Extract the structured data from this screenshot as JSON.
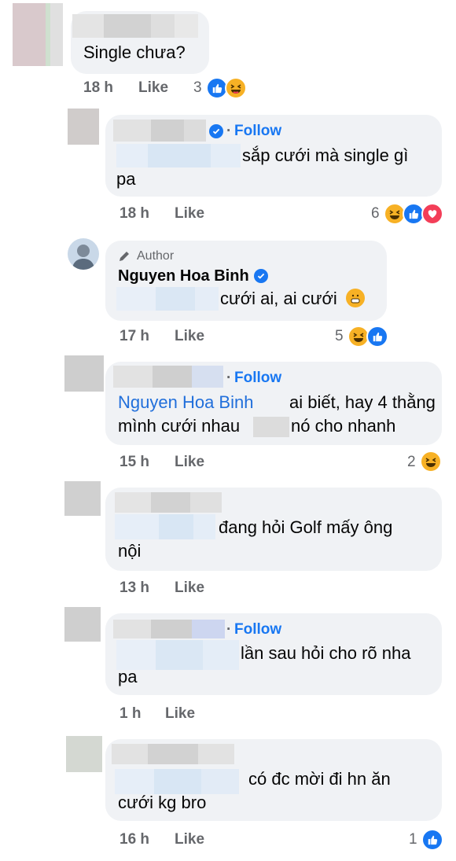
{
  "comments": [
    {
      "text": "Single chưa?",
      "time": "18 h",
      "like": "Like",
      "count": "3"
    },
    {
      "follow": "Follow",
      "text1": "sắp cưới mà single gì",
      "text2": "pa",
      "time": "18 h",
      "like": "Like",
      "count": "6"
    },
    {
      "badge": "Author",
      "name": "Nguyen Hoa Binh",
      "text": "cưới ai, ai cưới",
      "time": "17 h",
      "like": "Like",
      "count": "5"
    },
    {
      "follow": "Follow",
      "mention": "Nguyen Hoa Binh",
      "text1": "ai biết, hay 4 thằng",
      "text2a": "mình cưới nhau",
      "text2b": "nó cho nhanh",
      "time": "15 h",
      "like": "Like",
      "count": "2"
    },
    {
      "text1": "đang hỏi Golf mấy ông",
      "text2": "nội",
      "time": "13 h",
      "like": "Like"
    },
    {
      "follow": "Follow",
      "text1": "lần sau hỏi cho rõ nha",
      "text2": "pa",
      "time": "1 h",
      "like": "Like"
    },
    {
      "text1": "có đc mời đi hn ăn",
      "text2": "cưới kg bro",
      "time": "16 h",
      "like": "Like",
      "count": "1"
    }
  ],
  "colors": {
    "accent": "#1877f2",
    "bubble": "#f0f2f5",
    "meta": "#65676b"
  }
}
